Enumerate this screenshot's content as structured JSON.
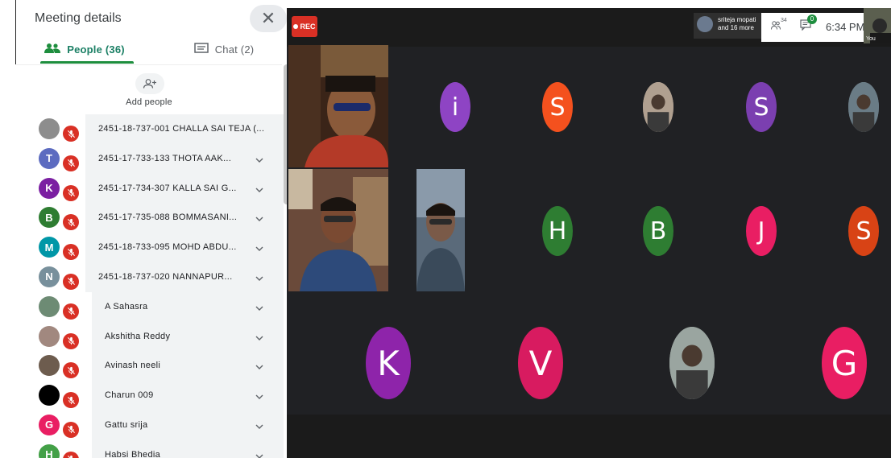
{
  "sidebar": {
    "title": "Meeting details",
    "close_label": "✕",
    "tabs": {
      "people": "People (36)",
      "chat": "Chat (2)"
    },
    "add_people_label": "Add people",
    "participants": [
      {
        "name": "2451-18-737-001 CHALLA SAI TEJA (...",
        "avatar": "",
        "color": "#8d8d8d",
        "chevron": false
      },
      {
        "name": "2451-17-733-133 THOTA AAK...",
        "avatar": "T",
        "color": "#5c6bc0",
        "chevron": true
      },
      {
        "name": "2451-17-734-307 KALLA SAI G...",
        "avatar": "K",
        "color": "#7b1fa2",
        "chevron": true
      },
      {
        "name": "2451-17-735-088 BOMMASANI...",
        "avatar": "B",
        "color": "#2e7d32",
        "chevron": true
      },
      {
        "name": "2451-18-733-095 MOHD ABDU...",
        "avatar": "M",
        "color": "#0097a7",
        "chevron": true
      },
      {
        "name": "2451-18-737-020 NANNAPUR...",
        "avatar": "N",
        "color": "#78909c",
        "chevron": true
      },
      {
        "name": "A Sahasra",
        "avatar": "",
        "color": "#6d8b74",
        "chevron": true
      },
      {
        "name": "Akshitha Reddy",
        "avatar": "",
        "color": "#a1887f",
        "chevron": true
      },
      {
        "name": "Avinash neeli",
        "avatar": "",
        "color": "#6d5c4e",
        "chevron": true
      },
      {
        "name": "Charun 009",
        "avatar": "",
        "color": "#000000",
        "chevron": true
      },
      {
        "name": "Gattu srija",
        "avatar": "G",
        "color": "#e91e63",
        "chevron": true
      },
      {
        "name": "Habsi Bhedia",
        "avatar": "H",
        "color": "#43a047",
        "chevron": true
      }
    ]
  },
  "meeting": {
    "rec_label": "REC",
    "presenter_line1": "sriteja mopati",
    "presenter_line2": "and 16 more",
    "people_count": "34",
    "chat_badge": "0",
    "time": "6:34 PM",
    "you_label": "You",
    "tiles": [
      {
        "letter": "i",
        "color": "#8e44c4"
      },
      {
        "letter": "S",
        "color": "#f4511e"
      },
      {
        "letter": "",
        "color": "#b0a090"
      },
      {
        "letter": "S",
        "color": "#7b3fb0"
      },
      {
        "letter": "",
        "color": "#6a7c86"
      },
      {
        "letter": "H",
        "color": "#2e7d32"
      },
      {
        "letter": "B",
        "color": "#2e7d32"
      },
      {
        "letter": "J",
        "color": "#e91e63"
      },
      {
        "letter": "S",
        "color": "#d84315"
      },
      {
        "letter": "K",
        "color": "#8e24aa"
      },
      {
        "letter": "V",
        "color": "#d81b60"
      },
      {
        "letter": "",
        "color": "#9aa5a0"
      },
      {
        "letter": "G",
        "color": "#e91e63"
      }
    ]
  }
}
